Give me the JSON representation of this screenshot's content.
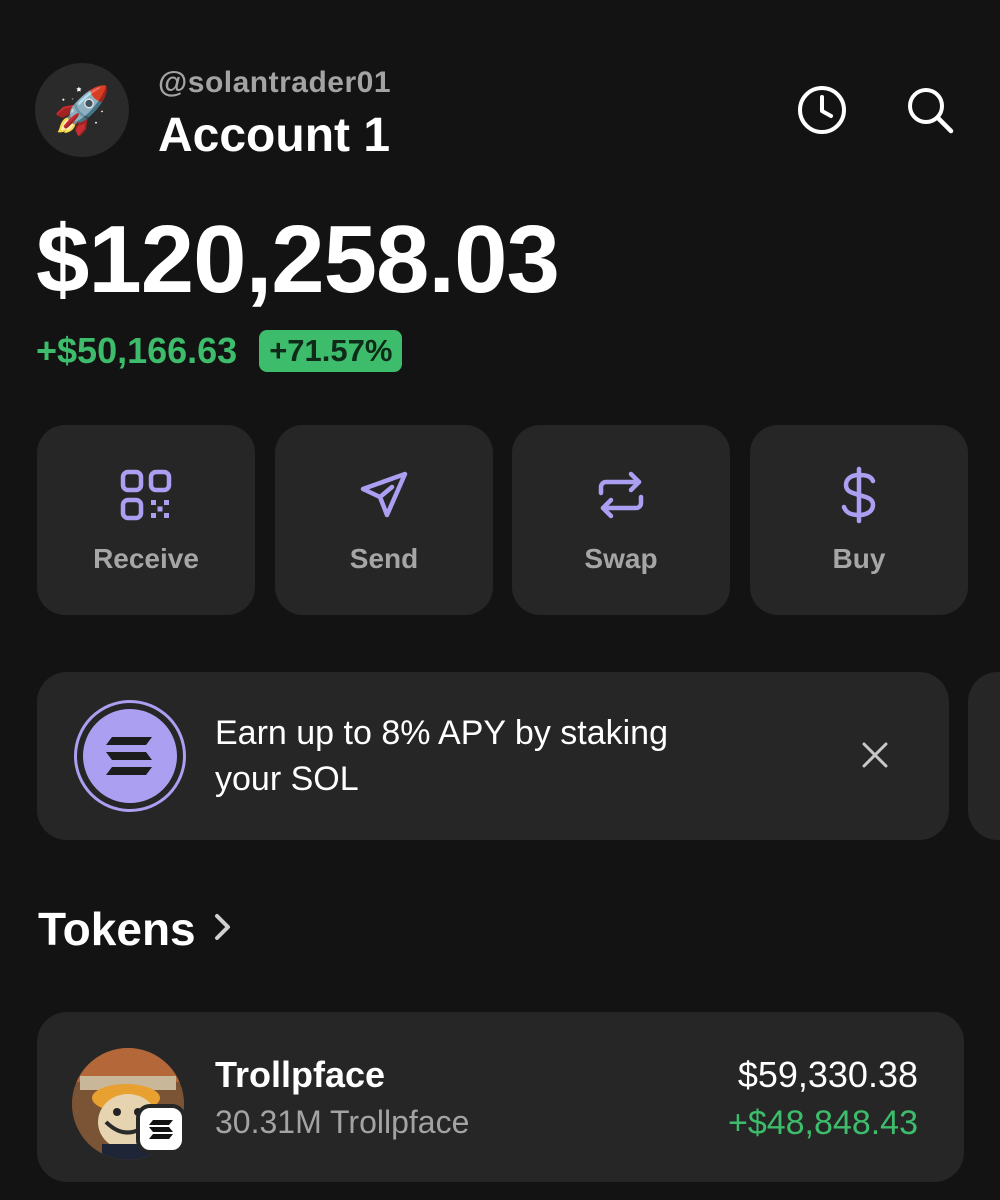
{
  "header": {
    "avatar_emoji": "🚀",
    "handle": "@solantrader01",
    "account_name": "Account 1",
    "icons": [
      "history-icon",
      "search-icon"
    ]
  },
  "balance": {
    "total": "$120,258.03",
    "change_amount": "+$50,166.63",
    "change_percent": "+71.57%"
  },
  "actions": [
    {
      "label": "Receive",
      "icon": "qr-code-icon"
    },
    {
      "label": "Send",
      "icon": "send-icon"
    },
    {
      "label": "Swap",
      "icon": "swap-icon"
    },
    {
      "label": "Buy",
      "icon": "dollar-icon"
    }
  ],
  "promo": {
    "text_line1": "Earn up to 8% APY by staking",
    "text_line2": "your SOL",
    "icon": "solana-logo-icon"
  },
  "tokens_section": {
    "title": "Tokens"
  },
  "tokens": [
    {
      "name": "Trollpface",
      "amount": "30.31M Trollpface",
      "value": "$59,330.38",
      "change": "+$48,848.43"
    }
  ],
  "colors": {
    "background": "#131313",
    "card": "#262626",
    "accent_purple": "#ab9ff2",
    "positive_green": "#3dbd6b",
    "muted_text": "#a3a3a3"
  }
}
